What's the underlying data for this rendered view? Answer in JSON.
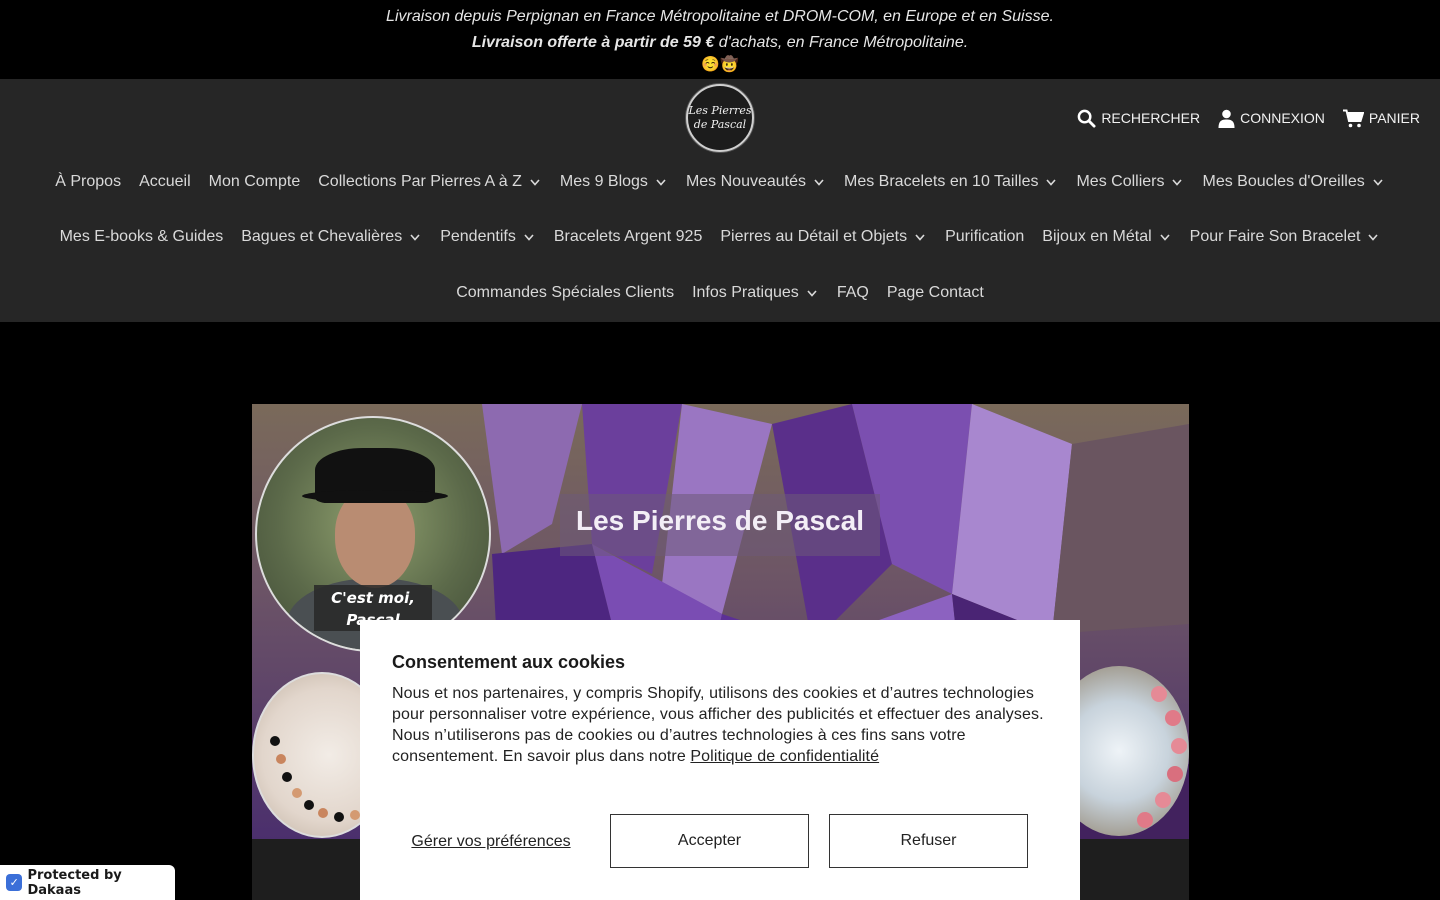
{
  "announcement": {
    "line1": "Livraison depuis Perpignan en France Métropolitaine et DROM-COM, en Europe et en Suisse.",
    "line2_bold": "Livraison offerte à partir de 59 €",
    "line2_rest": " d'achats, en France Métropolitaine.",
    "emojis": "☺️🤠"
  },
  "logo": {
    "line1": "Les Pierres",
    "line2": "de Pascal"
  },
  "header_actions": {
    "search": "RECHERCHER",
    "login": "CONNEXION",
    "cart": "PANIER"
  },
  "nav": {
    "row1": [
      {
        "label": "À Propos",
        "dropdown": false
      },
      {
        "label": "Accueil",
        "dropdown": false
      },
      {
        "label": "Mon Compte",
        "dropdown": false
      },
      {
        "label": "Collections Par Pierres A à Z",
        "dropdown": true
      },
      {
        "label": "Mes 9 Blogs",
        "dropdown": true
      },
      {
        "label": "Mes Nouveautés",
        "dropdown": true
      },
      {
        "label": "Mes Bracelets en 10 Tailles",
        "dropdown": true
      },
      {
        "label": "Mes Colliers",
        "dropdown": true
      },
      {
        "label": "Mes Boucles d'Oreilles",
        "dropdown": true
      }
    ],
    "row2": [
      {
        "label": "Mes E-books & Guides",
        "dropdown": false
      },
      {
        "label": "Bagues et Chevalières",
        "dropdown": true
      },
      {
        "label": "Pendentifs",
        "dropdown": true
      },
      {
        "label": "Bracelets Argent 925",
        "dropdown": false
      },
      {
        "label": "Pierres au Détail et Objets",
        "dropdown": true
      },
      {
        "label": "Purification",
        "dropdown": false
      },
      {
        "label": "Bijoux en Métal",
        "dropdown": true
      },
      {
        "label": "Pour Faire Son Bracelet",
        "dropdown": true
      }
    ],
    "row3": [
      {
        "label": "Commandes Spéciales Clients",
        "dropdown": false
      },
      {
        "label": "Infos Pratiques",
        "dropdown": true
      },
      {
        "label": "FAQ",
        "dropdown": false
      },
      {
        "label": "Page Contact",
        "dropdown": false
      }
    ]
  },
  "hero": {
    "title": "Les Pierres de Pascal",
    "caption_line1": "C'est moi,",
    "caption_line2": "Pascal"
  },
  "cookie": {
    "title": "Consentement aux cookies",
    "body": "Nous et nos partenaires, y compris Shopify, utilisons des cookies et d’autres technologies pour personnaliser votre expérience, vous afficher des publicités et effectuer des analyses. Nous n’utiliserons pas de cookies ou d’autres technologies à ces fins sans votre consentement. En savoir plus dans notre ",
    "policy_link": "Politique de confidentialité",
    "prefs": "Gérer vos préférences",
    "accept": "Accepter",
    "refuse": "Refuser"
  },
  "badge": {
    "label": "Protected by Dakaas",
    "icon": "shield-icon"
  }
}
